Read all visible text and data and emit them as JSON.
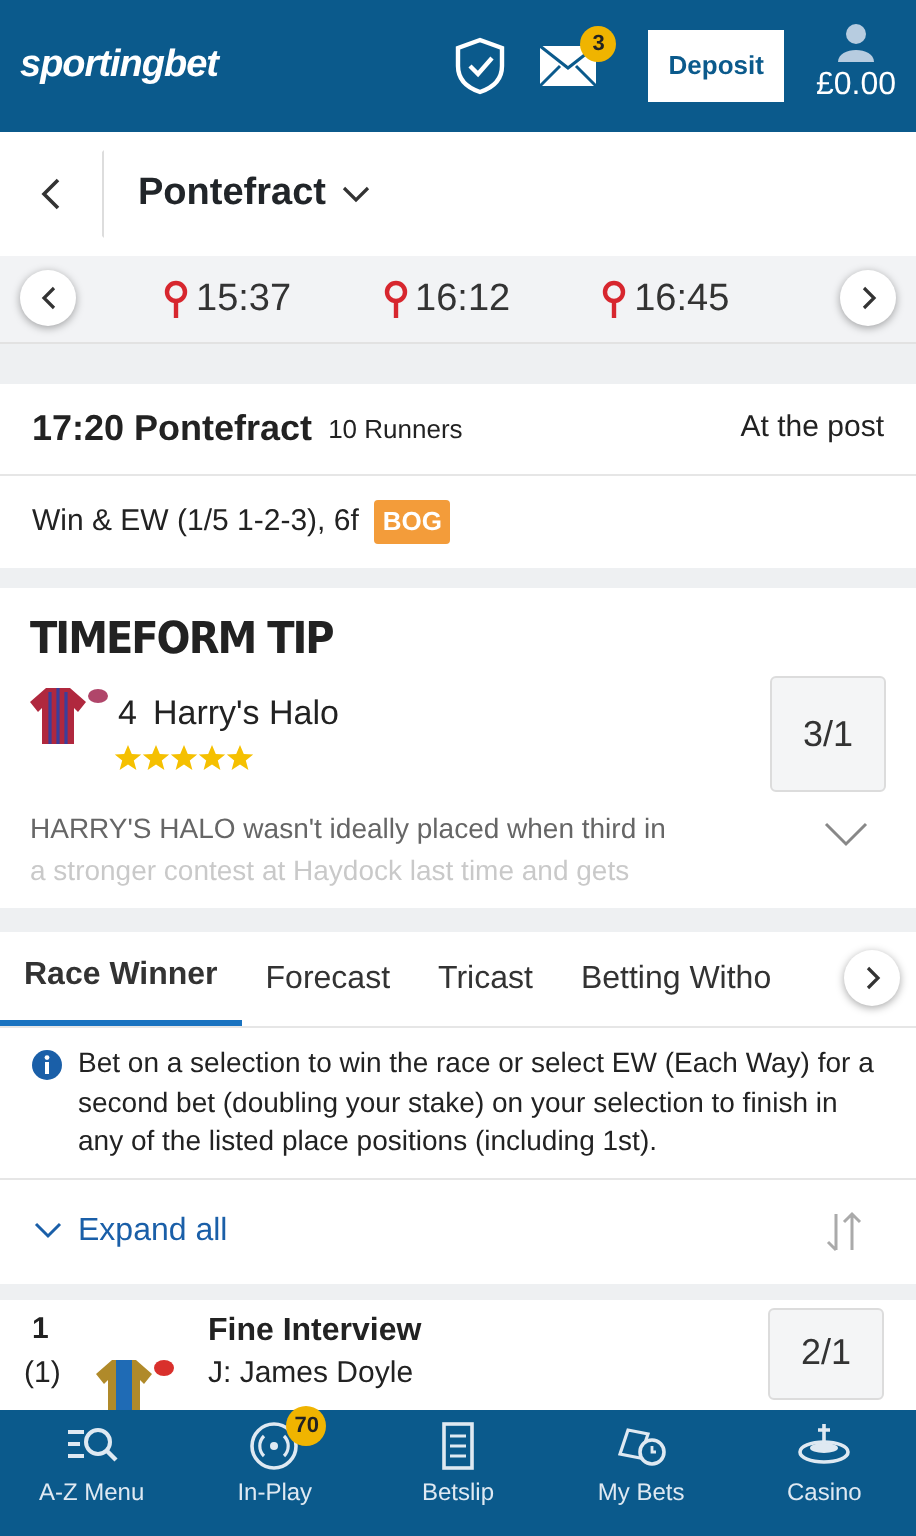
{
  "header": {
    "logo": "sportingbet",
    "mail_count": "3",
    "deposit": "Deposit",
    "balance": "£0.00"
  },
  "venue": {
    "title": "Pontefract"
  },
  "times": [
    {
      "label": "15:37"
    },
    {
      "label": "16:12"
    },
    {
      "label": "16:45"
    }
  ],
  "race": {
    "title": "17:20 Pontefract",
    "runners": "10 Runners",
    "status": "At the post",
    "terms": "Win & EW (1/5 1-2-3), 6f",
    "tag": "BOG"
  },
  "tip": {
    "heading": "TIMEFORM TIP",
    "number": "4",
    "horse": "Harry's Halo",
    "stars": 5,
    "odds": "3/1",
    "text": [
      "HARRY'S HALO wasn't ideally placed when third in",
      "a stronger contest at Haydock last time and gets"
    ]
  },
  "market_tabs": [
    {
      "label": "Race Winner",
      "selected": true
    },
    {
      "label": "Forecast",
      "selected": false
    },
    {
      "label": "Tricast",
      "selected": false
    },
    {
      "label": "Betting Witho",
      "selected": false
    }
  ],
  "info": "Bet on a selection to win the race or select EW (Each Way) for a second bet (doubling your stake) on your selection to finish in any of the listed place positions (including 1st).",
  "expand": "Expand all",
  "runners": [
    {
      "number": "1",
      "draw": "(1)",
      "name": "Fine Interview",
      "jockey": "J: James Doyle",
      "odds": "2/1"
    }
  ],
  "nav": [
    {
      "kind": "menu",
      "label": "A-Z Menu"
    },
    {
      "kind": "inplay",
      "label": "In-Play",
      "badge": "70"
    },
    {
      "kind": "betslip",
      "label": "Betslip"
    },
    {
      "kind": "mybets",
      "label": "My Bets"
    },
    {
      "kind": "casino",
      "label": "Casino"
    }
  ]
}
